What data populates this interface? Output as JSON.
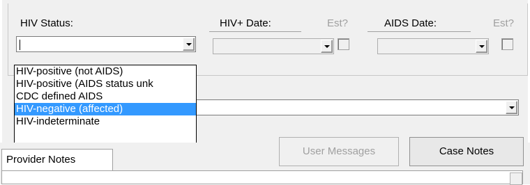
{
  "hiv_status": {
    "label": "HIV Status:",
    "value": ""
  },
  "hiv_date": {
    "label": "HIV+ Date:",
    "est_label": "Est?"
  },
  "aids_date": {
    "label": "AIDS Date:",
    "est_label": "Est?"
  },
  "dropdown": {
    "options": [
      "HIV-positive (not AIDS)",
      "HIV-positive (AIDS status unk",
      "CDC defined AIDS",
      "HIV-negative (affected)",
      "HIV-indeterminate"
    ],
    "selected_index": 3
  },
  "tabs": {
    "provider_notes": "Provider Notes"
  },
  "buttons": {
    "user_messages": "User Messages",
    "case_notes": "Case Notes"
  },
  "colors": {
    "selection": "#3399ff",
    "panel": "#f0f0f0"
  }
}
